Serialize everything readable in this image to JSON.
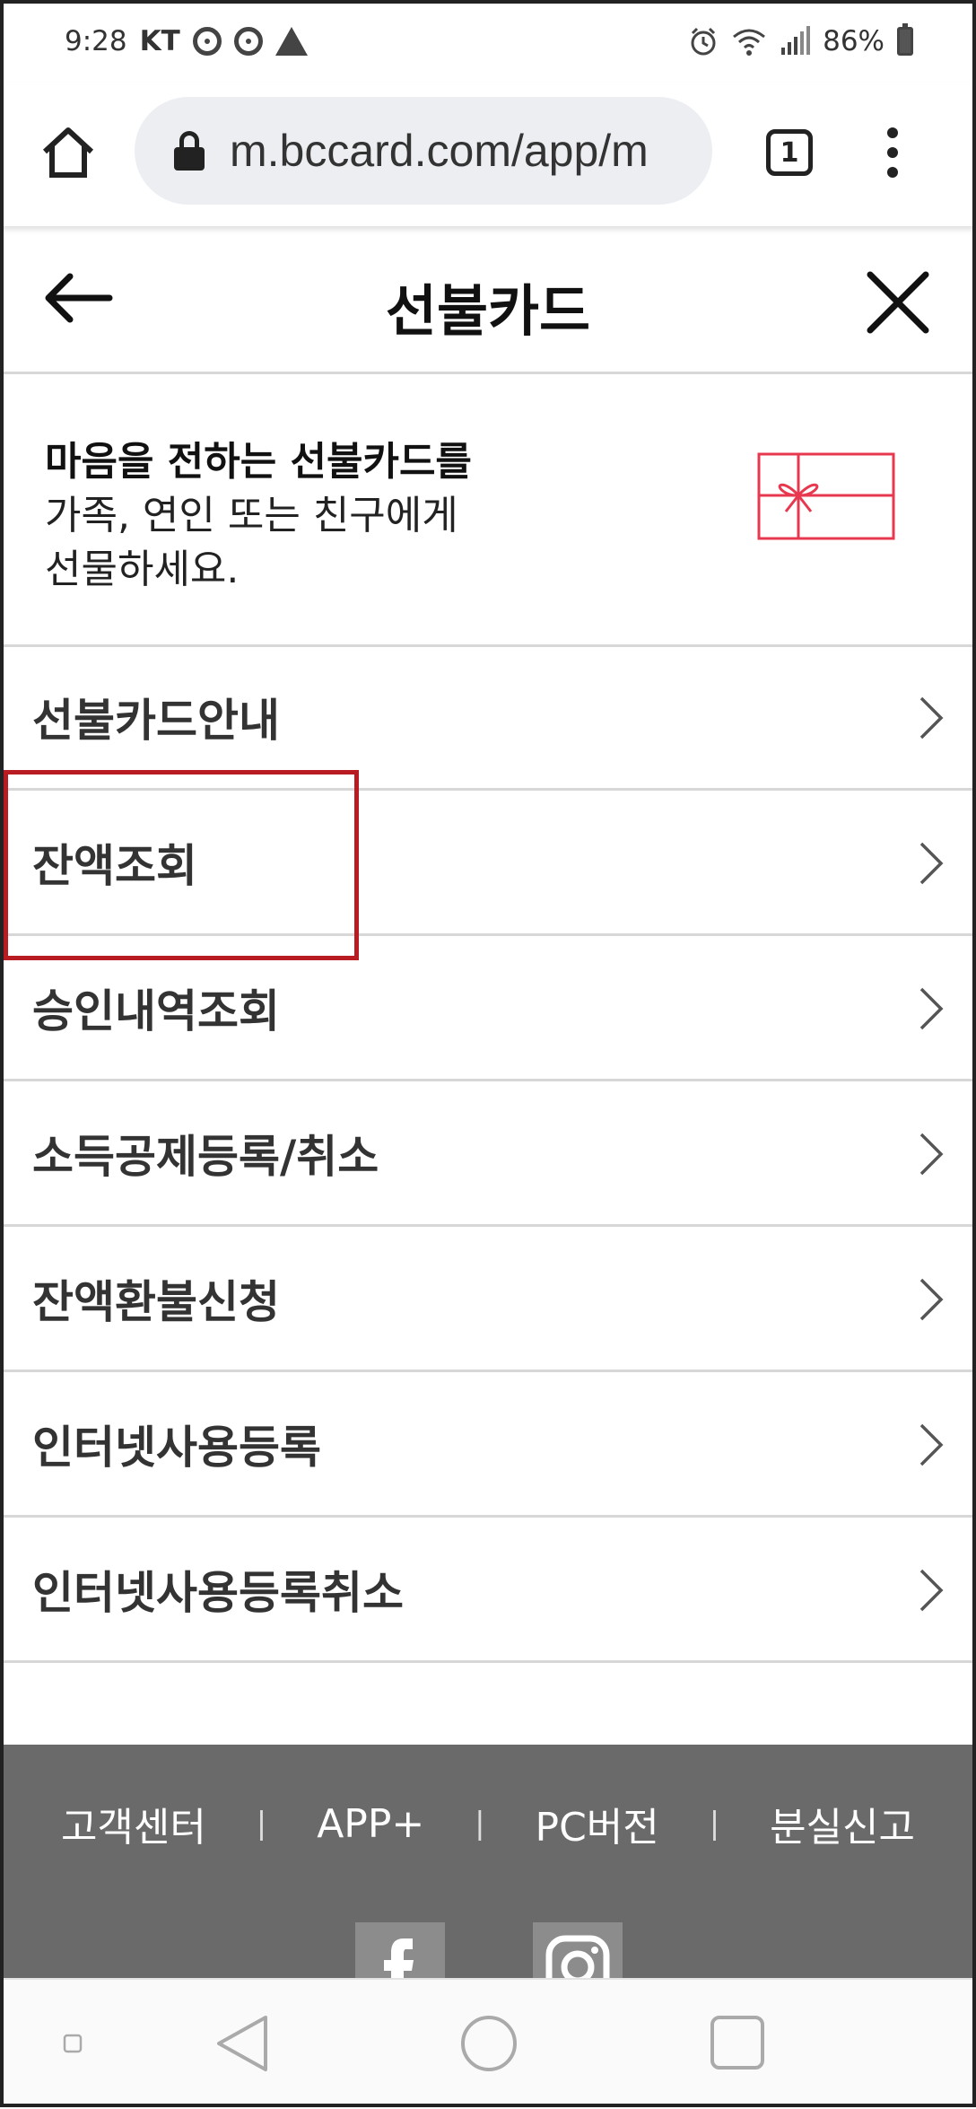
{
  "status_bar": {
    "time": "9:28",
    "carrier": "KT",
    "battery": "86%"
  },
  "browser": {
    "url": "m.bccard.com/app/m",
    "tab_count": "1"
  },
  "header": {
    "title": "선불카드"
  },
  "banner": {
    "headline": "마음을 전하는 선불카드를",
    "line2": "가족, 연인 또는 친구에게",
    "line3": "선물하세요."
  },
  "menu": [
    {
      "label": "선불카드안내"
    },
    {
      "label": "잔액조회"
    },
    {
      "label": "승인내역조회"
    },
    {
      "label": "소득공제등록/취소"
    },
    {
      "label": "잔액환불신청"
    },
    {
      "label": "인터넷사용등록"
    },
    {
      "label": "인터넷사용등록취소"
    }
  ],
  "footer": {
    "links": [
      {
        "label": "고객센터"
      },
      {
        "label": "APP+"
      },
      {
        "label": "PC버전"
      },
      {
        "label": "분실신고"
      }
    ],
    "separator": "|"
  },
  "colors": {
    "highlight": "#b81c22",
    "gift_icon": "#e8384f",
    "footer_bg": "#6a6a6a"
  },
  "icons": [
    "alarm-icon",
    "wifi-icon",
    "signal-icon",
    "battery-icon",
    "home-icon",
    "lock-icon",
    "more-vert-icon",
    "back-arrow-icon",
    "close-icon",
    "gift-card-icon",
    "chevron-right-icon",
    "facebook-icon",
    "instagram-icon"
  ]
}
